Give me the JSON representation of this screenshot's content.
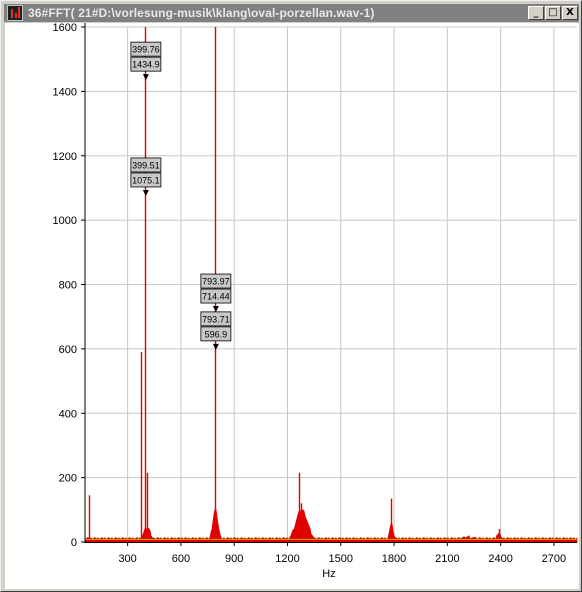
{
  "window": {
    "title": "36#FFT( 21#D:\\vorlesung-musik\\klang\\oval-porzellan.wav-1)",
    "controls": {
      "minimize": "_",
      "maximize": "□",
      "close": "X"
    }
  },
  "colors": {
    "spectrum": "#e00000",
    "noise_floor": "#b8b800",
    "grid": "#c8c8c8",
    "titlebar": "#808080"
  },
  "markers": [
    {
      "freq": "399.76",
      "amp": "1434.9",
      "x": 400,
      "y": 1434.9
    },
    {
      "freq": "399.51",
      "amp": "1075.1",
      "x": 400,
      "y": 1075.1
    },
    {
      "freq": "793.97",
      "amp": "714.44",
      "x": 794,
      "y": 714.44
    },
    {
      "freq": "793.71",
      "amp": "596.9",
      "x": 794,
      "y": 596.9
    }
  ],
  "chart_data": {
    "type": "area",
    "title": "",
    "xlabel": "Hz",
    "ylabel": "",
    "xlim": [
      60,
      2830
    ],
    "ylim": [
      0,
      1600
    ],
    "xticks": [
      "300",
      "600",
      "900",
      "1200",
      "1500",
      "1800",
      "2100",
      "2400",
      "2700"
    ],
    "yticks": [
      "0",
      "200",
      "400",
      "600",
      "800",
      "1000",
      "1200",
      "1400",
      "1600"
    ],
    "grid": true,
    "peaks": [
      {
        "x": 80,
        "y": 145
      },
      {
        "x": 375,
        "y": 590
      },
      {
        "x": 400,
        "y": 1600
      },
      {
        "x": 410,
        "y": 215
      },
      {
        "x": 794,
        "y": 1600
      },
      {
        "x": 1265,
        "y": 215
      },
      {
        "x": 1275,
        "y": 120
      },
      {
        "x": 1785,
        "y": 135
      },
      {
        "x": 2390,
        "y": 40
      }
    ],
    "bumps": [
      {
        "x": 410,
        "y": 40,
        "w": 25
      },
      {
        "x": 794,
        "y": 95,
        "w": 20
      },
      {
        "x": 1280,
        "y": 95,
        "w": 45
      },
      {
        "x": 1785,
        "y": 50,
        "w": 15
      },
      {
        "x": 2390,
        "y": 25,
        "w": 12
      },
      {
        "x": 2220,
        "y": 10,
        "w": 40
      }
    ],
    "noise_floor": 8
  }
}
